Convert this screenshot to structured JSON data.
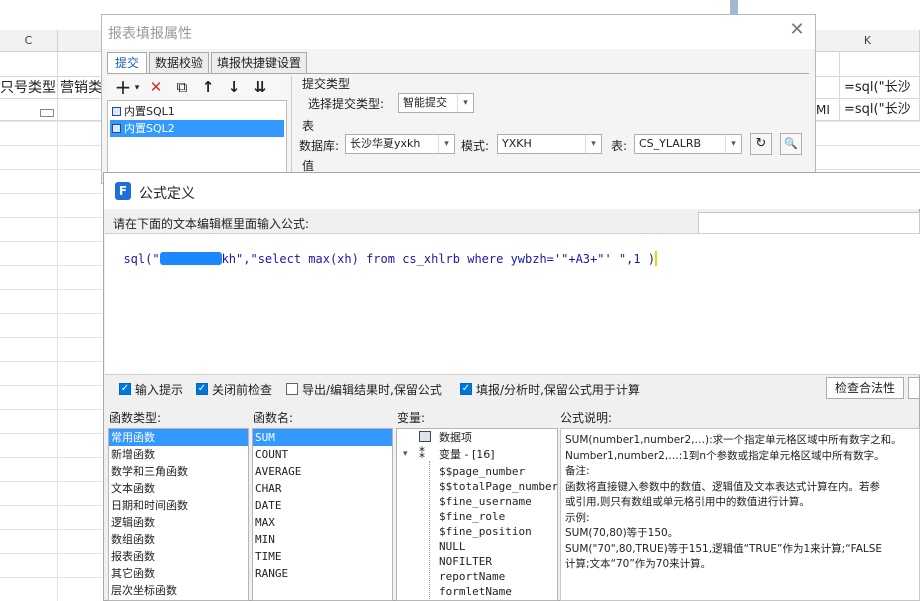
{
  "sheet": {
    "col_c": "C",
    "col_k": "K",
    "cell_a": "只号类型",
    "cell_b": "营销类",
    "cell_k1": "=sql(\"长沙",
    "cell_k2": "=sql(\"长沙",
    "cell_j2": "MI"
  },
  "prop_dialog": {
    "title": "报表填报属性",
    "tabs": [
      "提交",
      "数据校验",
      "填报快捷键设置"
    ],
    "toolbar": {
      "add": "+",
      "add_caret": "▾",
      "delete": "✕",
      "copy": "⧉",
      "up": "↑",
      "down": "↓",
      "more": "⇊"
    },
    "sql_items": [
      "内置SQL1",
      "内置SQL2"
    ],
    "submit_type_section": "提交类型",
    "submit_type_label": "选择提交类型:",
    "submit_type_value": "智能提交",
    "table_section": "表",
    "db_label": "数据库:",
    "db_value": "长沙华夏yxkh",
    "mode_label": "模式:",
    "mode_value": "YXKH",
    "table_label": "表:",
    "table_value": "CS_YLALRB",
    "value_section": "值",
    "refresh_icon": "↻",
    "search_icon": "🔍"
  },
  "formula_dialog": {
    "title": "公式定义",
    "prompt": "请在下面的文本编辑框里面输入公式:",
    "formula": {
      "p1": "sql(\"",
      "p2": "kh\",\"select max(xh) from cs_xhlrb where ywbzh='\"+A3+\"' \",1 )"
    },
    "options": [
      {
        "label": "输入提示",
        "checked": true
      },
      {
        "label": "关闭前检查",
        "checked": true
      },
      {
        "label": "导出/编辑结果时,保留公式",
        "checked": false
      },
      {
        "label": "填报/分析时,保留公式用于计算",
        "checked": true
      }
    ],
    "check_button": "检查合法性",
    "func_type_label": "函数类型:",
    "func_types": [
      "常用函数",
      "新增函数",
      "数学和三角函数",
      "文本函数",
      "日期和时间函数",
      "逻辑函数",
      "数组函数",
      "报表函数",
      "其它函数",
      "层次坐标函数"
    ],
    "func_name_label": "函数名:",
    "func_names": [
      "SUM",
      "COUNT",
      "AVERAGE",
      "CHAR",
      "DATE",
      "MAX",
      "MIN",
      "TIME",
      "RANGE"
    ],
    "var_label": "变量:",
    "var_data_item": "数据项",
    "var_group": "变量 - [16]",
    "var_items": [
      "$$page_number",
      "$$totalPage_number",
      "$fine_username",
      "$fine_role",
      "$fine_position",
      "NULL",
      "NOFILTER",
      "reportName",
      "formletName"
    ],
    "desc_label": "公式说明:",
    "desc_lines": [
      "SUM(number1,number2,…):求一个指定单元格区域中所有数字之和。",
      "Number1,number2,…:1到n个参数或指定单元格区域中所有数字。",
      "备注:",
      "函数将直接键入参数中的数值、逻辑值及文本表达式计算在内。若参",
      "或引用,则只有数组或单元格引用中的数值进行计算。",
      "示例:",
      "SUM(70,80)等于150。",
      "SUM(\"70\",80,TRUE)等于151,逻辑值“TRUE”作为1来计算;“FALSE",
      "计算;文本“70”作为70来计算。"
    ]
  }
}
